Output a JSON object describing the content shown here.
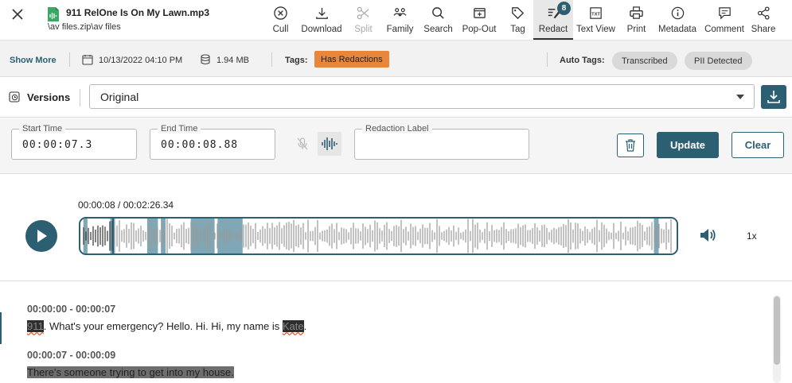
{
  "file": {
    "name": "911 RelOne Is On My Lawn.mp3",
    "path": "\\av files.zip\\av files"
  },
  "toolbar": {
    "items": [
      {
        "label": "Cull",
        "icon": "cull-icon"
      },
      {
        "label": "Download",
        "icon": "download-icon"
      },
      {
        "label": "Split",
        "icon": "scissors-icon",
        "disabled": true
      },
      {
        "label": "Family",
        "icon": "family-icon"
      },
      {
        "label": "Search",
        "icon": "search-icon"
      },
      {
        "label": "Pop-Out",
        "icon": "pop-out-icon"
      },
      {
        "label": "Tag",
        "icon": "tag-icon"
      },
      {
        "label": "Redact",
        "icon": "redact-icon",
        "active": true,
        "badge": "8"
      },
      {
        "label": "Text View",
        "icon": "text-view-icon"
      },
      {
        "label": "Print",
        "icon": "print-icon"
      },
      {
        "label": "Metadata",
        "icon": "metadata-icon"
      },
      {
        "label": "Comment",
        "icon": "comment-icon"
      },
      {
        "label": "Share",
        "icon": "share-icon"
      }
    ]
  },
  "info": {
    "show_more": "Show More",
    "date": "10/13/2022 04:10 PM",
    "size": "1.94 MB",
    "tags_label": "Tags:",
    "tag": "Has Redactions",
    "auto_tags_label": "Auto Tags:",
    "auto_tags": [
      "Transcribed",
      "PII Detected"
    ]
  },
  "versions": {
    "label": "Versions",
    "selected": "Original"
  },
  "redaction_form": {
    "start_label": "Start Time",
    "start_value": "00:00:07.3",
    "end_label": "End Time",
    "end_value": "00:00:08.88",
    "redaction_label": "Redaction Label",
    "redaction_value": "",
    "update_label": "Update",
    "clear_label": "Clear"
  },
  "player": {
    "time": "00:00:08 / 00:02:26.34",
    "speed": "1x",
    "duration_seconds": 146.34,
    "position_seconds": 8,
    "redacted_ranges_fraction": [
      [
        0.005,
        0.012
      ],
      [
        0.05,
        0.058
      ],
      [
        0.112,
        0.13
      ],
      [
        0.135,
        0.143
      ],
      [
        0.185,
        0.225
      ],
      [
        0.23,
        0.272
      ],
      [
        0.962,
        0.97
      ]
    ]
  },
  "transcript": {
    "segments": [
      {
        "time": "00:00:00 - 00:00:07",
        "parts": [
          {
            "text": "911",
            "redacted": true
          },
          {
            "text": ". What's your emergency? Hello. Hi. Hi, my name is "
          },
          {
            "text": "Kate",
            "redacted": true
          },
          {
            "text": "."
          }
        ]
      },
      {
        "time": "00:00:07 - 00:00:09",
        "parts": [
          {
            "text": "There's someone trying to get into my house.",
            "redacted_line": true
          }
        ]
      }
    ]
  },
  "colors": {
    "accent": "#2d5f73",
    "tag_orange": "#e8873a",
    "redaction_overlay": "#7fa7b5"
  }
}
